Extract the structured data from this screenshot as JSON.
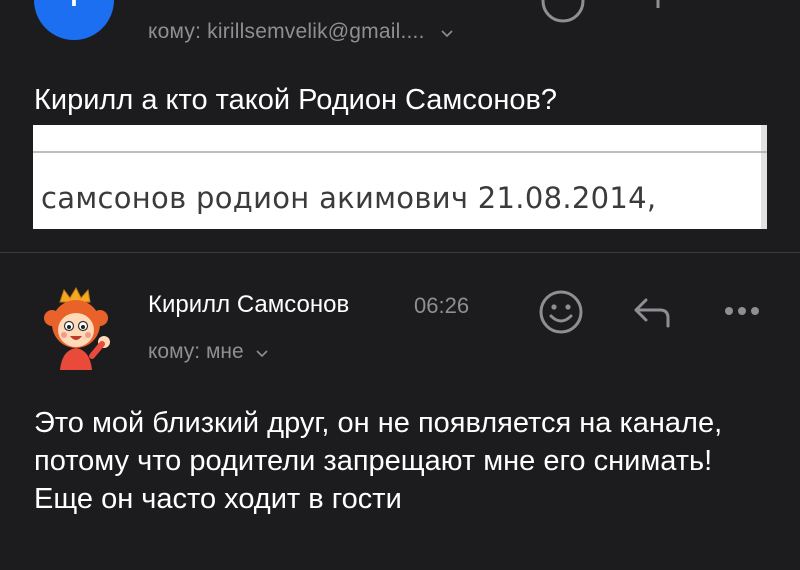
{
  "top_message": {
    "avatar_letter": "T",
    "recipient_line": "кому: kirillsemvelik@gmail....",
    "body": "Кирилл а кто такой Родион Самсонов?",
    "attachment_text": "самсонов родион акимович 21.08.2014, "
  },
  "reply_message": {
    "sender": "Кирилл Самсонов",
    "time": "06:26",
    "recipient_line": "кому: мне",
    "body": "Это мой близкий друг, он не появляется на канале, потому что родители запрещают мне его снимать! Еще он часто ходит в гости"
  },
  "icons": {
    "emoji": "smiley-icon",
    "reply": "reply-arrow-icon",
    "more": "more-dots-icon",
    "chevron": "chevron-down-icon"
  },
  "colors": {
    "background": "#1c1c1e",
    "secondary_text": "#8e8e93",
    "avatar_blue": "#1d6ff2",
    "divider": "#3a3a3c"
  }
}
